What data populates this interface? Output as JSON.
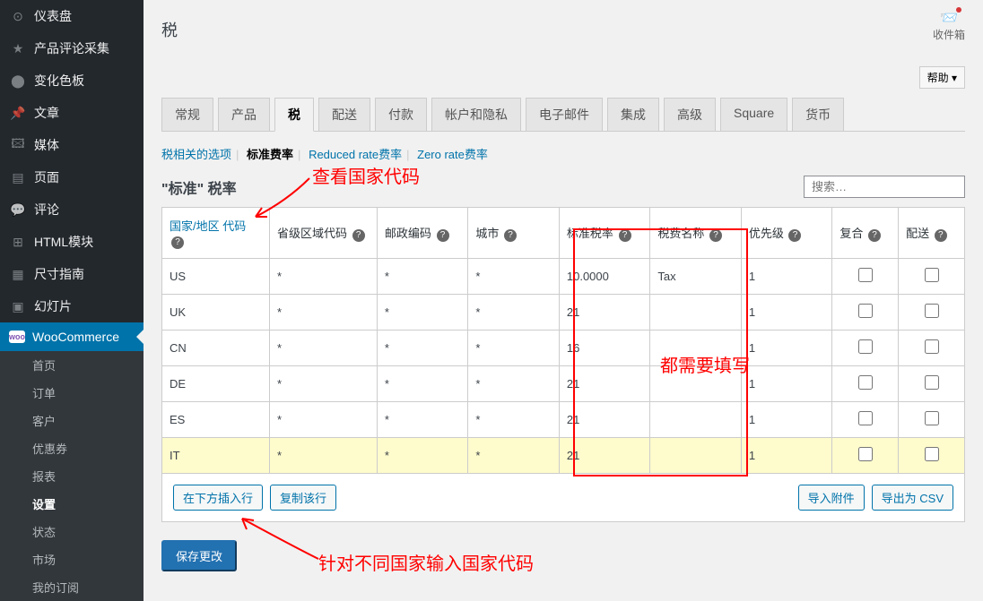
{
  "sidebar": {
    "items": [
      {
        "label": "仪表盘",
        "icon": "dashboard"
      },
      {
        "label": "产品评论采集",
        "icon": "star"
      },
      {
        "label": "变化色板",
        "icon": "palette"
      },
      {
        "label": "文章",
        "icon": "pin"
      },
      {
        "label": "媒体",
        "icon": "media"
      },
      {
        "label": "页面",
        "icon": "page"
      },
      {
        "label": "评论",
        "icon": "comment"
      },
      {
        "label": "HTML模块",
        "icon": "html"
      },
      {
        "label": "尺寸指南",
        "icon": "size"
      },
      {
        "label": "幻灯片",
        "icon": "slides"
      }
    ],
    "woocommerce_label": "WooCommerce",
    "submenu": [
      "首页",
      "订单",
      "客户",
      "优惠券",
      "报表",
      "设置",
      "状态",
      "市场",
      "我的订阅"
    ],
    "submenu_active": "设置"
  },
  "topbar": {
    "title": "税",
    "inbox_label": "收件箱",
    "help_label": "帮助"
  },
  "tabs": [
    "常规",
    "产品",
    "税",
    "配送",
    "付款",
    "帐户和隐私",
    "电子邮件",
    "集成",
    "高级",
    "Square",
    "货币"
  ],
  "active_tab": "税",
  "subtabs": {
    "option": "税相关的选项",
    "standard": "标准费率",
    "reduced": "Reduced rate费率",
    "zero": "Zero rate费率"
  },
  "section_title": "\"标准\" 税率",
  "search_placeholder": "搜索…",
  "columns": {
    "country": "国家/地区 代码",
    "state": "省级区域代码",
    "postcode": "邮政编码",
    "city": "城市",
    "rate": "标准税率",
    "name": "税费名称",
    "priority": "优先级",
    "compound": "复合",
    "shipping": "配送"
  },
  "rows": [
    {
      "country": "US",
      "state": "*",
      "postcode": "*",
      "city": "*",
      "rate": "10.0000",
      "name": "Tax",
      "priority": "1"
    },
    {
      "country": "UK",
      "state": "*",
      "postcode": "*",
      "city": "*",
      "rate": "21",
      "name": "",
      "priority": "1"
    },
    {
      "country": "CN",
      "state": "*",
      "postcode": "*",
      "city": "*",
      "rate": "16",
      "name": "",
      "priority": "1"
    },
    {
      "country": "DE",
      "state": "*",
      "postcode": "*",
      "city": "*",
      "rate": "21",
      "name": "",
      "priority": "1"
    },
    {
      "country": "ES",
      "state": "*",
      "postcode": "*",
      "city": "*",
      "rate": "21",
      "name": "",
      "priority": "1"
    },
    {
      "country": "IT",
      "state": "*",
      "postcode": "*",
      "city": "*",
      "rate": "21",
      "name": "",
      "priority": "1"
    }
  ],
  "actions": {
    "insert": "在下方插入行",
    "copy": "复制该行",
    "import": "导入附件",
    "export": "导出为 CSV",
    "save": "保存更改"
  },
  "annotations": {
    "top": "查看国家代码",
    "middle": "都需要填写",
    "bottom": "针对不同国家输入国家代码"
  }
}
